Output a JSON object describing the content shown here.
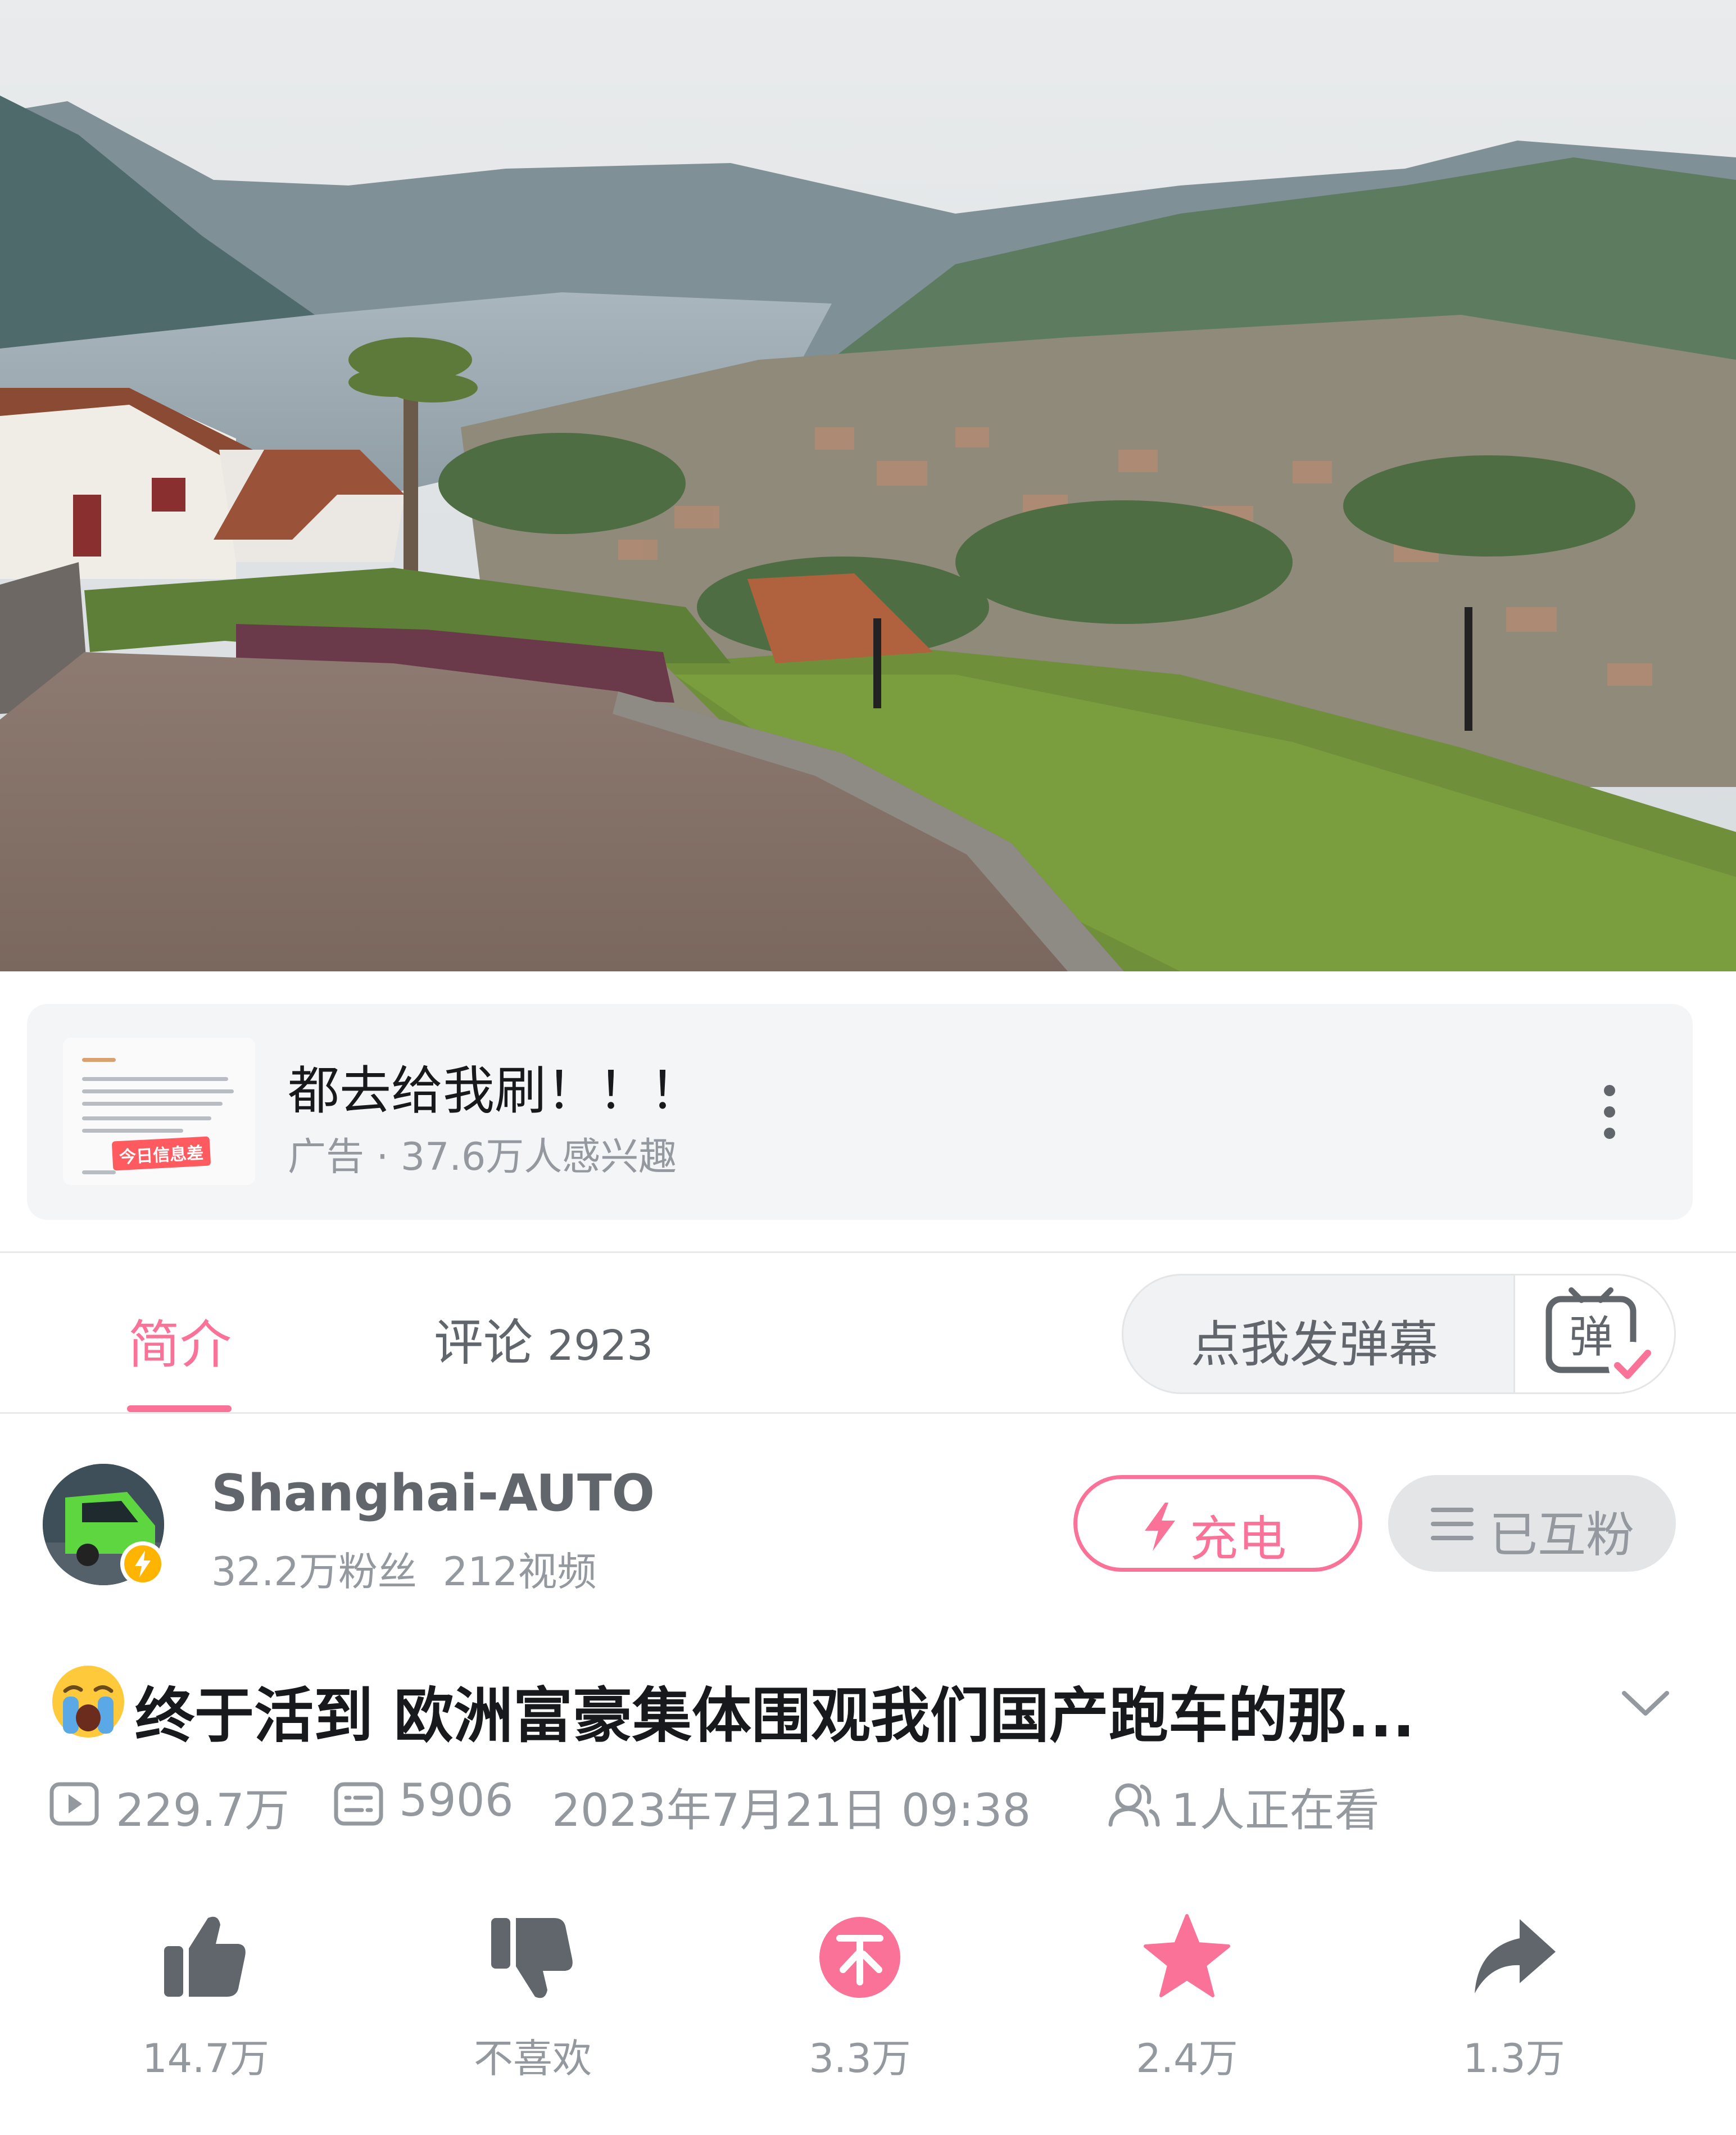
{
  "ad": {
    "title": "都去给我刷！！！",
    "subtitle": "广告 · 37.6万人感兴趣",
    "thumbnail_stamp": "今日信息差"
  },
  "tabs": {
    "intro": "简介",
    "comments_label": "评论",
    "comments_count": "2923"
  },
  "danmaku": {
    "input_placeholder": "点我发弹幕",
    "toggle_glyph": "弹"
  },
  "uploader": {
    "name": "Shanghai-AUTO",
    "followers": "32.2万粉丝",
    "videos": "212视频",
    "charge_label": "充电",
    "followed_label": "已互粉"
  },
  "video": {
    "title": "终于活到 欧洲富豪集体围观我们国产跑车的那...",
    "plays": "229.7万",
    "danmaku_count": "5906",
    "publish_time": "2023年7月21日 09:38",
    "watching": "1人正在看"
  },
  "actions": {
    "like": "14.7万",
    "dislike": "不喜欢",
    "coin": "3.3万",
    "favorite": "2.4万",
    "share": "1.3万"
  },
  "colors": {
    "accent_pink": "#fb7299",
    "text_secondary": "#9499a0",
    "text_primary": "#18191c"
  },
  "icons": [
    "more-vertical-icon",
    "danmaku-toggle-icon",
    "lightning-icon",
    "menu-icon",
    "crying-emoji-icon",
    "chevron-down-icon",
    "play-count-icon",
    "danmaku-count-icon",
    "viewers-icon",
    "thumb-up-icon",
    "thumb-down-icon",
    "coin-icon",
    "star-icon",
    "share-icon"
  ]
}
